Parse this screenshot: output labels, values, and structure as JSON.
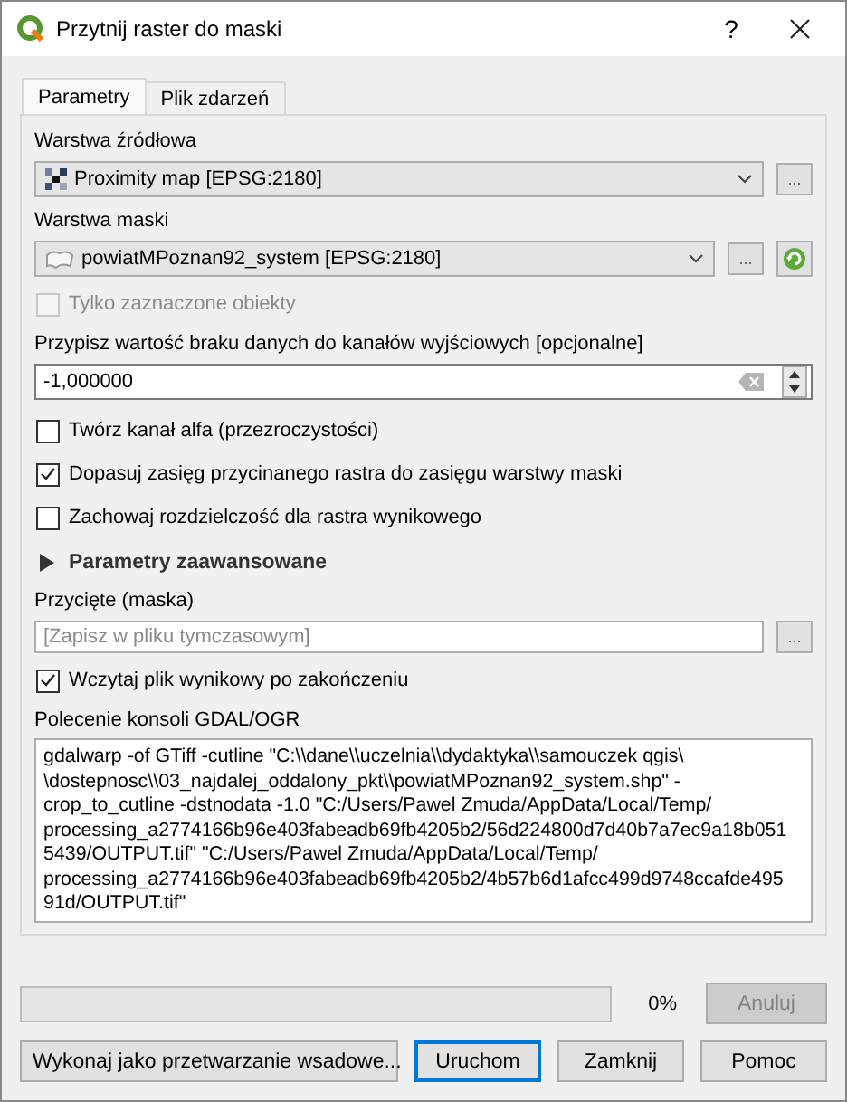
{
  "window": {
    "title": "Przytnij raster do maski",
    "help": "?"
  },
  "tabs": [
    {
      "label": "Parametry",
      "selected": true
    },
    {
      "label": "Plik zdarzeń",
      "selected": false
    }
  ],
  "source_layer": {
    "label": "Warstwa źródłowa",
    "value": "Proximity map [EPSG:2180]",
    "button": "..."
  },
  "mask_layer": {
    "label": "Warstwa maski",
    "value": "powiatMPoznan92_system [EPSG:2180]",
    "button": "..."
  },
  "selected_only": {
    "label": "Tylko zaznaczone obiekty",
    "checked": false,
    "disabled": true
  },
  "nodata": {
    "label": "Przypisz wartość braku danych do kanałów wyjściowych [opcjonalne]",
    "value": "-1,000000"
  },
  "options": [
    {
      "label": "Twórz kanał alfa (przezroczystości)",
      "checked": false
    },
    {
      "label": "Dopasuj zasięg przycinanego rastra do zasięgu warstwy maski",
      "checked": true
    },
    {
      "label": "Zachowaj rozdzielczość dla rastra wynikowego",
      "checked": false
    }
  ],
  "advanced": {
    "label": "Parametry zaawansowane",
    "expanded": false
  },
  "output": {
    "label": "Przycięte (maska)",
    "placeholder": "[Zapisz w pliku tymczasowym]",
    "button": "..."
  },
  "open_output": {
    "label": "Wczytaj plik wynikowy po zakończeniu",
    "checked": true
  },
  "console": {
    "label": "Polecenie konsoli GDAL/OGR",
    "command": "gdalwarp -of GTiff -cutline \"C:\\\\dane\\\\uczelnia\\\\dydaktyka\\\\samouczek qgis\\\n\\dostepnosc\\\\03_najdalej_oddalony_pkt\\\\powiatMPoznan92_system.shp\" -\ncrop_to_cutline -dstnodata -1.0 \"C:/Users/Pawel Zmuda/AppData/Local/Temp/\nprocessing_a2774166b96e403fabeadb69fb4205b2/56d224800d7d40b7a7ec9a18b051\n5439/OUTPUT.tif\" \"C:/Users/Pawel Zmuda/AppData/Local/Temp/\nprocessing_a2774166b96e403fabeadb69fb4205b2/4b57b6d1afcc499d9748ccafde495\n91d/OUTPUT.tif\""
  },
  "progress": {
    "reading": "0%",
    "cancel": {
      "label": "Anuluj",
      "disabled": true
    }
  },
  "buttons": [
    {
      "label": "Wykonaj jako przetwarzanie wsadowe...",
      "default": false
    },
    {
      "label": "Uruchom",
      "default": true
    },
    {
      "label": "Zamknij",
      "default": false
    },
    {
      "label": "Pomoc",
      "default": false
    }
  ]
}
